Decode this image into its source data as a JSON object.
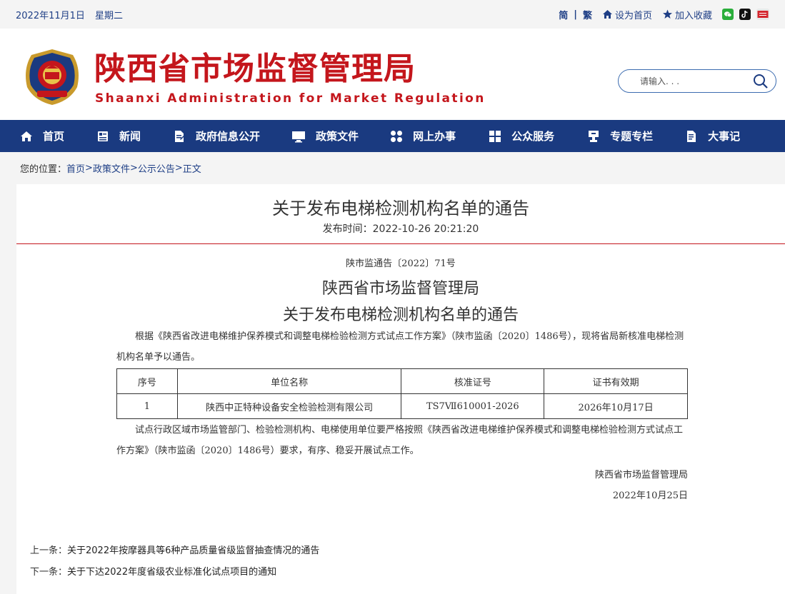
{
  "topbar": {
    "date": "2022年11月1日",
    "weekday": "星期二",
    "lang_simplified": "简",
    "lang_traditional": "繁",
    "set_home": "设为首页",
    "add_fav": "加入收藏"
  },
  "header": {
    "title": "陕西省市场监督管理局",
    "subtitle": "Shaanxi  Administration for Market Regulation",
    "search_placeholder": "请输入. . ."
  },
  "nav": [
    {
      "label": "首页",
      "icon": "home-icon"
    },
    {
      "label": "新闻",
      "icon": "news-icon"
    },
    {
      "label": "政府信息公开",
      "icon": "doc-edit-icon"
    },
    {
      "label": "政策文件",
      "icon": "monitor-icon"
    },
    {
      "label": "网上办事",
      "icon": "grid-circles-icon"
    },
    {
      "label": "公众服务",
      "icon": "grid-squares-icon"
    },
    {
      "label": "专题专栏",
      "icon": "trophy-icon"
    },
    {
      "label": "大事记",
      "icon": "notebook-icon"
    }
  ],
  "breadcrumb": {
    "prefix": "您的位置：",
    "items": [
      "首页",
      ">",
      "政策文件",
      ">",
      "公示公告",
      ">",
      "正文"
    ]
  },
  "article": {
    "title": "关于发布电梯检测机构名单的通告",
    "time_label": "发布时间：",
    "time": "2022-10-26 20:21:20",
    "doc_number": "陕市监通告〔2022〕71号",
    "heading_org": "陕西省市场监督管理局",
    "heading_title": "关于发布电梯检测机构名单的通告",
    "para1": "根据《陕西省改进电梯维护保养模式和调整电梯检验检测方式试点工作方案》（陕市监函〔2020〕1486号），现将省局新核准电梯检测机构名单予以通告。",
    "table": {
      "headers": [
        "序号",
        "单位名称",
        "核准证号",
        "证书有效期"
      ],
      "rows": [
        [
          "1",
          "陕西中正特种设备安全检验检测有限公司",
          "TS7Ⅶ610001-2026",
          "2026年10月17日"
        ]
      ]
    },
    "para2": "试点行政区域市场监管部门、检验检测机构、电梯使用单位要严格按照《陕西省改进电梯维护保养模式和调整电梯检验检测方式试点工作方案》（陕市监函〔2020〕1486号）要求，有序、稳妥开展试点工作。",
    "sign_org": "陕西省市场监督管理局",
    "sign_date": "2022年10月25日"
  },
  "pager": {
    "prev_label": "上一条：",
    "prev_title": "关于2022年按摩器具等6种产品质量省级监督抽查情况的通告",
    "next_label": "下一条：",
    "next_title": "关于下达2022年度省级农业标准化试点项目的通知"
  },
  "colors": {
    "brand_red": "#c4161c",
    "nav_blue": "#1a3a80",
    "link_blue": "#1f3f86"
  }
}
